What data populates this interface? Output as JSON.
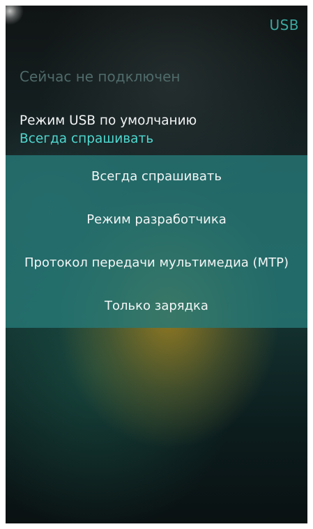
{
  "header": {
    "title": "USB"
  },
  "status": {
    "text": "Сейчас не подключен"
  },
  "default_mode": {
    "label": "Режим USB по умолчанию",
    "value": "Всегда спрашивать"
  },
  "menu": {
    "items": [
      {
        "label": "Всегда спрашивать"
      },
      {
        "label": "Режим разработчика"
      },
      {
        "label": "Протокол передачи мультимедиа (MTP)"
      },
      {
        "label": "Только зарядка"
      }
    ]
  },
  "colors": {
    "accent": "#4ed8cf",
    "title": "#3aa8a0",
    "menu_background": "#267876"
  }
}
